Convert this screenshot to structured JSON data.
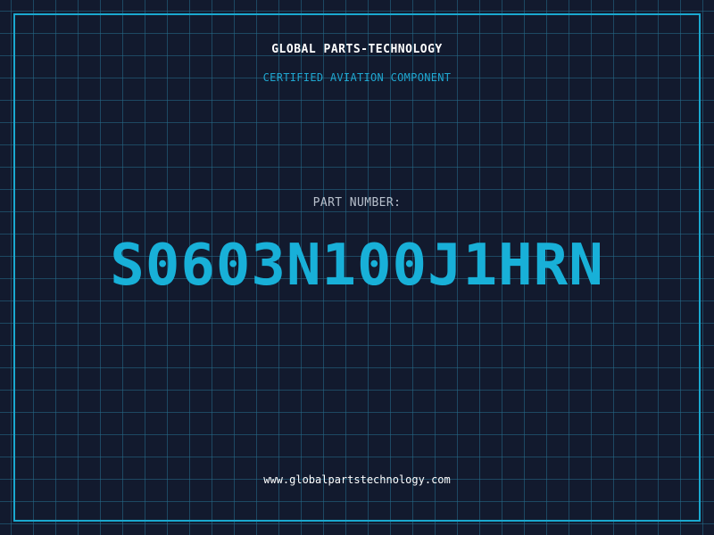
{
  "header": {
    "company": "GLOBAL PARTS-TECHNOLOGY",
    "subtitle": "CERTIFIED AVIATION COMPONENT"
  },
  "part": {
    "label": "PART NUMBER:",
    "number": "S0603N100J1HRN"
  },
  "footer": {
    "website": "www.globalpartstechnology.com"
  },
  "colors": {
    "background": "#121a2e",
    "grid": "#266e8c",
    "accent": "#18b0d8",
    "text": "#ffffff"
  }
}
